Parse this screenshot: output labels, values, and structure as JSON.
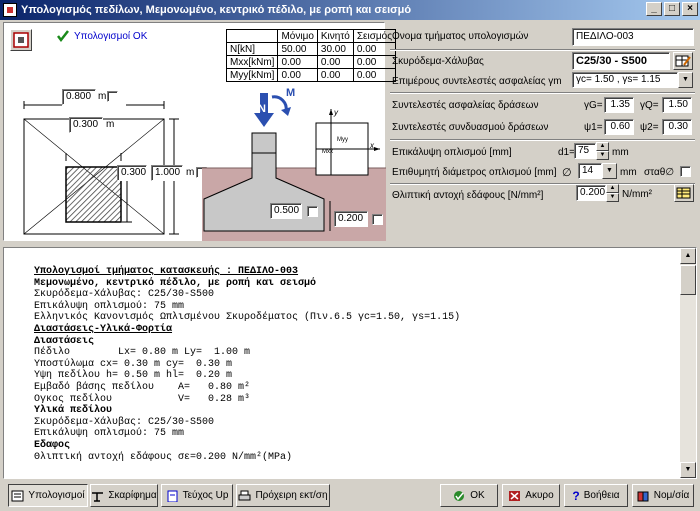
{
  "window": {
    "title": "Υπολογισμός πεδίλων, Μεμονωμένο, κεντρικό πέδιλο, με ροπή και σεισμό"
  },
  "status": {
    "text": "Υπολογισμοί ΟΚ"
  },
  "loads": {
    "headers": [
      "",
      "Μόνιμο",
      "Κινητό",
      "Σεισμός"
    ],
    "rows": [
      [
        "N[kN]",
        "50.00",
        "30.00",
        "0.00"
      ],
      [
        "Mxx[kNm]",
        "0.00",
        "0.00",
        "0.00"
      ],
      [
        "Myy[kNm]",
        "0.00",
        "0.00",
        "0.00"
      ]
    ]
  },
  "plan": {
    "Lx": "0.800",
    "Lx_unit": "m",
    "cx": "0.300",
    "cx_unit": "m",
    "cy": "0.300",
    "Ly": "1.000",
    "Ly_unit": "m"
  },
  "section": {
    "N": "N",
    "M": "M",
    "h": "0.500",
    "hl": "0.200",
    "axis_y": "y",
    "axis_x": "x",
    "myy": "Myy",
    "mxx": "Mxx"
  },
  "form": {
    "name_label": "Ονομα τμήματος υπολογισμών",
    "name_value": "ΠΕΔΙΛΟ-003",
    "material_label": "Σκυρόδεμα-Χάλυβας",
    "material_value": "C25/30 - S500",
    "partial_label": "Επιμέρους συντελεστές ασφαλείας γm",
    "partial_value": "γc= 1.50 , γs= 1.15",
    "safety_label": "Συντελεστές ασφαλείας δράσεων",
    "gG_label": "γG=",
    "gG_value": "1.35",
    "gQ_label": "γQ=",
    "gQ_value": "1.50",
    "comb_label": "Συντελεστές συνδυασμού δράσεων",
    "psi1_label": "ψ1=",
    "psi1_value": "0.60",
    "psi2_label": "ψ2=",
    "psi2_value": "0.30",
    "cover_label": "Επικάλυψη οπλισμού [mm]",
    "d1_label": "d1=",
    "d1_value": "75",
    "d1_unit": "mm",
    "diam_label": "Επιθυμητή διάμετρος οπλισμού [mm]",
    "diam_symbol": "∅",
    "diam_value": "14",
    "diam_unit": "mm",
    "stath_label": "σταθ∅",
    "soil_label": "Θλιπτική αντοχή εδάφους [N/mm²]",
    "soil_value": "0.200",
    "soil_unit": "N/mm²"
  },
  "report": {
    "lines": [
      {
        "t": "Υπολογισμοί τμήματος κατασκευής : ΠΕΔΙΛΟ-003",
        "s": "u"
      },
      {
        "t": "Μεμονωμένο, κεντρικό πέδιλο, με ροπή και σεισμό",
        "s": "b"
      },
      {
        "t": "Σκυρόδεμα-Χάλυβας: C25/30-S500",
        "s": ""
      },
      {
        "t": "Επικάλυψη οπλισμού: 75 mm",
        "s": ""
      },
      {
        "t": "Ελληνικός Κανονισμός Ωπλισμένου Σκυροδέματος (Πιν.6.5 γc=1.50, γs=1.15)",
        "s": ""
      },
      {
        "t": "Διαστάσεις-Υλικά-Φορτία",
        "s": "u"
      },
      {
        "t": "Διαστάσεις",
        "s": "b"
      },
      {
        "t": "Πέδιλο        Lx= 0.80 m Ly=  1.00 m",
        "s": ""
      },
      {
        "t": "Υποστύλωμα cx= 0.30 m cy=  0.30 m",
        "s": ""
      },
      {
        "t": "Υψη πεδίλου h= 0.50 m hl=  0.20 m",
        "s": ""
      },
      {
        "t": "Εμβαδό βάσης πεδίλου    A=   0.80 m²",
        "s": ""
      },
      {
        "t": "Ογκος πεδίλου           V=   0.28 m³",
        "s": ""
      },
      {
        "t": "Υλικά πεδίλου",
        "s": "b"
      },
      {
        "t": "Σκυρόδεμα-Χάλυβας: C25/30-S500",
        "s": ""
      },
      {
        "t": "Επικάλυψη οπλισμού: 75 mm",
        "s": ""
      },
      {
        "t": "Εδαφος",
        "s": "b"
      },
      {
        "t": "Θλιπτική αντοχή εδάφους σε=0.200 N/mm²(MPa)",
        "s": ""
      }
    ]
  },
  "buttons": {
    "calc": "Υπολογισμοί",
    "sketch": "Σκαρίφημα",
    "teuxos": "Τεύχος Up",
    "print": "Πρόχειρη εκτ/ση",
    "ok": "OK",
    "cancel": "Ακυρο",
    "help": "Βοήθεια",
    "norms": "Νομ/σία"
  },
  "colors": {
    "titlebar": "#0a246a",
    "soil": "#9c8080",
    "ground": "#c9a7a7",
    "ok_check": "#1a8a1a",
    "status_text": "#0000cc"
  }
}
